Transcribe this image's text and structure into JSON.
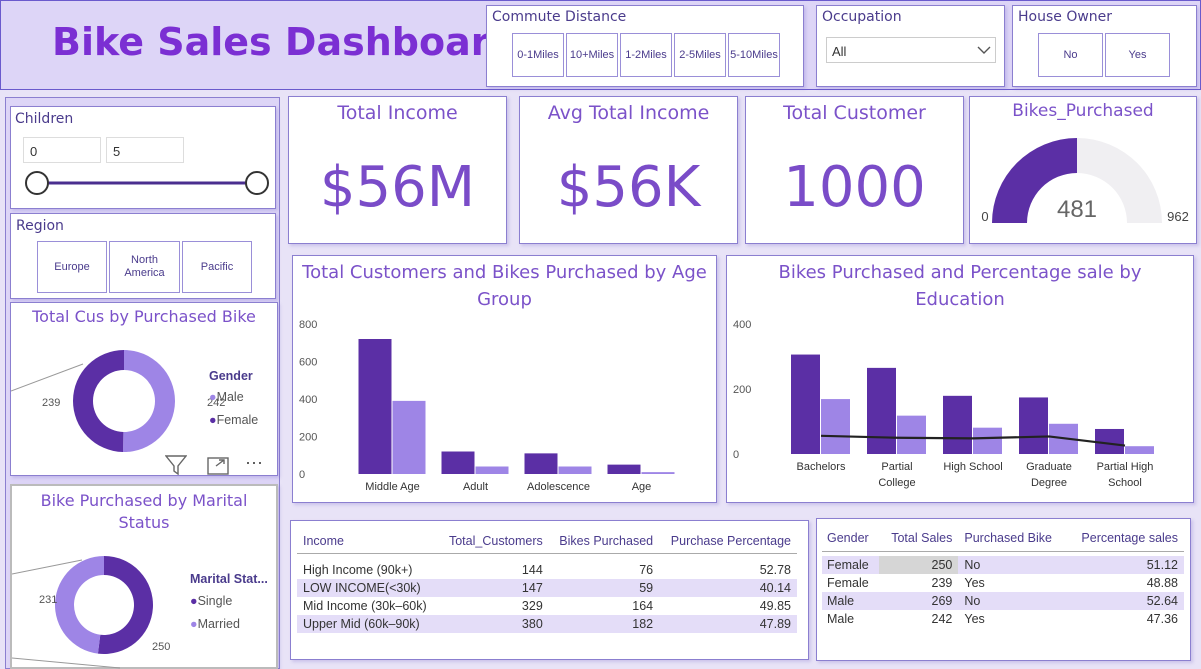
{
  "title": "Bike Sales Dashboard",
  "colors": {
    "dark": "#5b2fa5",
    "light": "#9e85e6",
    "line": "#222222",
    "gauge_bg": "#f0eff2"
  },
  "commute": {
    "label": "Commute Distance",
    "options": [
      [
        "0-1",
        "Miles"
      ],
      [
        "10+",
        "Miles"
      ],
      [
        "1-2",
        "Miles"
      ],
      [
        "2-5",
        "Miles"
      ],
      [
        "5-10",
        "Miles"
      ]
    ]
  },
  "occupation": {
    "label": "Occupation",
    "value": "All"
  },
  "house_owner": {
    "label": "House Owner",
    "options": [
      "No",
      "Yes"
    ]
  },
  "children": {
    "label": "Children",
    "min": "0",
    "max": "5"
  },
  "region": {
    "label": "Region",
    "options": [
      "Europe",
      "North America",
      "Pacific"
    ]
  },
  "kpis": [
    {
      "title": "Total Income",
      "value": "$56M"
    },
    {
      "title": "Avg Total Income",
      "value": "$56K"
    },
    {
      "title": "Total Customer",
      "value": "1000"
    }
  ],
  "gauge": {
    "title": "Bikes_Purchased",
    "value": "481",
    "min": "0",
    "max": "962"
  },
  "icons": [
    "filter-icon",
    "expand-icon",
    "more-options-icon"
  ],
  "chart_data": [
    {
      "type": "pie",
      "title": "Total Cus by Purchased Bike",
      "legend_title": "Gender",
      "categories": [
        "Male",
        "Female"
      ],
      "values": [
        242,
        239
      ]
    },
    {
      "type": "pie",
      "title": "Bike Purchased by Marital Status",
      "legend_title": "Marital Stat...",
      "categories": [
        "Single",
        "Married"
      ],
      "values": [
        250,
        231
      ]
    },
    {
      "type": "bar",
      "title": "Total Customers and Bikes Purchased by Age Group",
      "categories": [
        "Middle Age",
        "Adult",
        "Adolescence",
        "Age"
      ],
      "series": [
        {
          "values": [
            720,
            120,
            110,
            50
          ]
        },
        {
          "values": [
            390,
            40,
            40,
            10
          ]
        }
      ],
      "ylim": [
        0,
        800
      ],
      "yticks": [
        "0",
        "200",
        "400",
        "600",
        "800"
      ],
      "legend": "none"
    },
    {
      "type": "bar",
      "title": "Bikes Purchased and Percentage sale by Education",
      "categories": [
        "Bachelors",
        "Partial College",
        "High School",
        "Graduate Degree",
        "Partial High School"
      ],
      "series": [
        {
          "values": [
            306,
            265,
            179,
            174,
            77
          ]
        },
        {
          "values": [
            169,
            118,
            81,
            93,
            24
          ]
        },
        {
          "type": "line",
          "values": [
            56,
            50,
            48,
            54,
            26
          ]
        }
      ],
      "ylim": [
        0,
        400
      ],
      "yticks": [
        "0",
        "200",
        "400"
      ],
      "legend": "none"
    }
  ],
  "income_table": {
    "headers": [
      "Income",
      "Total_Customers",
      "Bikes Purchased",
      "Purchase Percentage"
    ],
    "rows": [
      [
        "High Income (90k+)",
        "144",
        "76",
        "52.78"
      ],
      [
        "LOW INCOME(<30k)",
        "147",
        "59",
        "40.14"
      ],
      [
        "Mid Income (30k–60k)",
        "329",
        "164",
        "49.85"
      ],
      [
        "Upper Mid (60k–90k)",
        "380",
        "182",
        "47.89"
      ]
    ]
  },
  "gender_table": {
    "headers": [
      "Gender",
      "Total Sales",
      "Purchased Bike",
      "Percentage sales"
    ],
    "rows": [
      [
        "Female",
        "250",
        "No",
        "51.12"
      ],
      [
        "Female",
        "239",
        "Yes",
        "48.88"
      ],
      [
        "Male",
        "269",
        "No",
        "52.64"
      ],
      [
        "Male",
        "242",
        "Yes",
        "47.36"
      ]
    ]
  }
}
